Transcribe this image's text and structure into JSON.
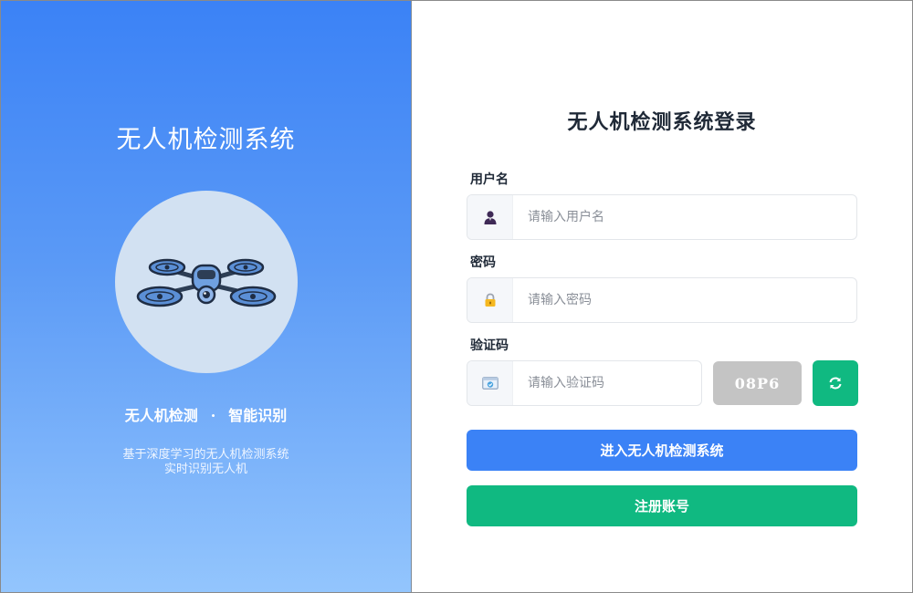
{
  "brand": {
    "title": "无人机检测系统",
    "tagline_left": "无人机检测",
    "tagline_sep": "·",
    "tagline_right": "智能识别",
    "desc_line1": "基于深度学习的无人机检测系统",
    "desc_line2": "实时识别无人机",
    "illustration_icon": "drone-icon"
  },
  "login": {
    "title": "无人机检测系统登录",
    "username": {
      "label": "用户名",
      "placeholder": "请输入用户名",
      "value": "",
      "icon": "user-icon"
    },
    "password": {
      "label": "密码",
      "placeholder": "请输入密码",
      "value": "",
      "icon": "lock-icon"
    },
    "captcha": {
      "label": "验证码",
      "placeholder": "请输入验证码",
      "value": "",
      "icon": "captcha-icon",
      "code": "08P6",
      "refresh_icon": "refresh-icon"
    },
    "submit_label": "进入无人机检测系统",
    "register_label": "注册账号"
  },
  "colors": {
    "gradient_top": "#3b82f6",
    "gradient_bottom": "#93c5fd",
    "primary": "#3b82f6",
    "success": "#10b981",
    "captcha_bg": "#c4c4c4"
  }
}
